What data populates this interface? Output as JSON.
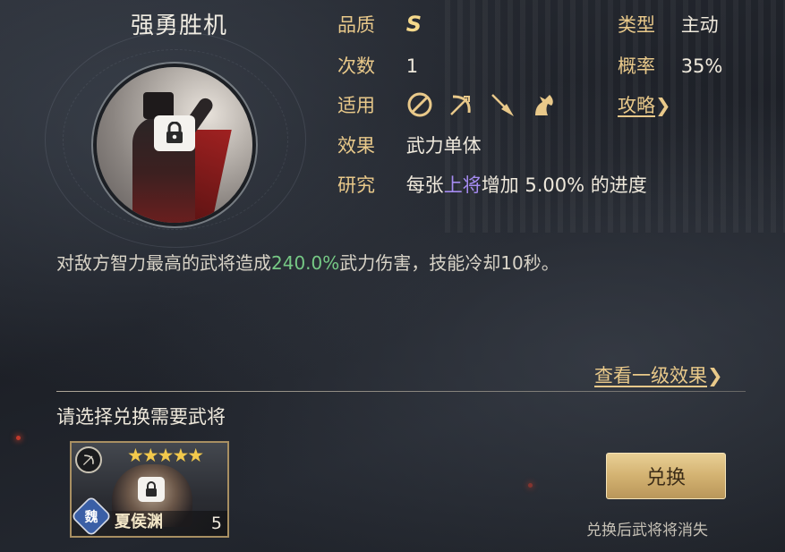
{
  "skill": {
    "title": "强勇胜机",
    "quality_label": "品质",
    "quality_value": "S",
    "count_label": "次数",
    "count_value": "1",
    "applicable_label": "适用",
    "applicable_icons": [
      "shield-icon",
      "bow-icon",
      "spear-icon",
      "horse-icon"
    ],
    "effect_label": "效果",
    "effect_value": "武力单体",
    "research_label": "研究",
    "research_prefix": "每张",
    "research_highlight": "上将",
    "research_suffix": "增加 5.00% 的进度",
    "type_label": "类型",
    "type_value": "主动",
    "rate_label": "概率",
    "rate_value": "35%",
    "guide_link": "攻略",
    "guide_chevron": "❯"
  },
  "description": {
    "prefix": "对敌方智力最高的武将造成",
    "highlight": "240.0%",
    "suffix": "武力伤害，技能冷却10秒。"
  },
  "level_effect_link": "查看一级效果",
  "level_effect_chevron": "❯",
  "exchange": {
    "title": "请选择兑换需要武将",
    "general": {
      "stars": "★★★★★",
      "faction": "魏",
      "name": "夏侯渊",
      "count": "5"
    },
    "button_label": "兑换",
    "hint": "兑换后武将将消失"
  },
  "colors": {
    "gold_label": "#e9c98a",
    "highlight_purple": "#a58bf0",
    "highlight_green": "#76c985",
    "button_gold": "#d3b271"
  }
}
